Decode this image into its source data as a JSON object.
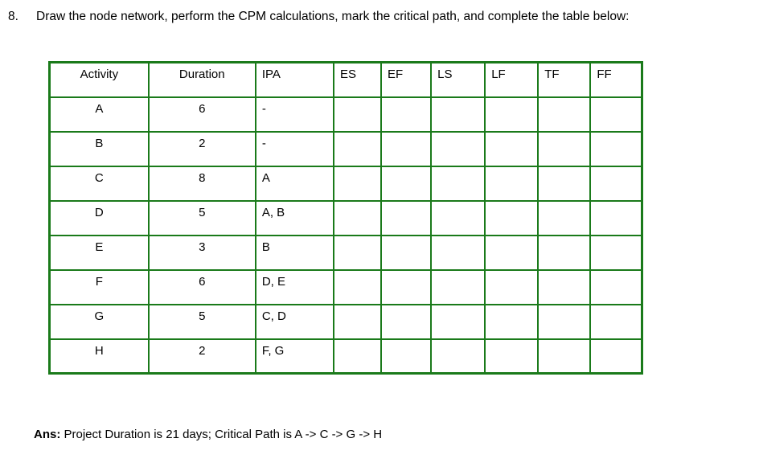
{
  "question": {
    "number": "8.",
    "text": "Draw the node network, perform the CPM calculations, mark the critical path, and complete the table below:"
  },
  "table": {
    "headers": [
      {
        "key": "activity",
        "label": "Activity",
        "align": "center"
      },
      {
        "key": "duration",
        "label": "Duration",
        "align": "center"
      },
      {
        "key": "ipa",
        "label": "IPA",
        "align": "left"
      },
      {
        "key": "es",
        "label": "ES",
        "align": "left"
      },
      {
        "key": "ef",
        "label": "EF",
        "align": "left"
      },
      {
        "key": "ls",
        "label": "LS",
        "align": "left"
      },
      {
        "key": "lf",
        "label": "LF",
        "align": "left"
      },
      {
        "key": "tf",
        "label": "TF",
        "align": "left"
      },
      {
        "key": "ff",
        "label": "FF",
        "align": "left"
      }
    ],
    "rows": [
      {
        "activity": "A",
        "duration": "6",
        "ipa": "-",
        "es": "",
        "ef": "",
        "ls": "",
        "lf": "",
        "tf": "",
        "ff": ""
      },
      {
        "activity": "B",
        "duration": "2",
        "ipa": "-",
        "es": "",
        "ef": "",
        "ls": "",
        "lf": "",
        "tf": "",
        "ff": ""
      },
      {
        "activity": "C",
        "duration": "8",
        "ipa": "A",
        "es": "",
        "ef": "",
        "ls": "",
        "lf": "",
        "tf": "",
        "ff": ""
      },
      {
        "activity": "D",
        "duration": "5",
        "ipa": "A, B",
        "es": "",
        "ef": "",
        "ls": "",
        "lf": "",
        "tf": "",
        "ff": ""
      },
      {
        "activity": "E",
        "duration": "3",
        "ipa": "B",
        "es": "",
        "ef": "",
        "ls": "",
        "lf": "",
        "tf": "",
        "ff": ""
      },
      {
        "activity": "F",
        "duration": "6",
        "ipa": "D, E",
        "es": "",
        "ef": "",
        "ls": "",
        "lf": "",
        "tf": "",
        "ff": ""
      },
      {
        "activity": "G",
        "duration": "5",
        "ipa": "C, D",
        "es": "",
        "ef": "",
        "ls": "",
        "lf": "",
        "tf": "",
        "ff": ""
      },
      {
        "activity": "H",
        "duration": "2",
        "ipa": "F, G",
        "es": "",
        "ef": "",
        "ls": "",
        "lf": "",
        "tf": "",
        "ff": ""
      }
    ],
    "border_color": "#1a7a1a"
  },
  "answer": {
    "lead": "Ans:",
    "text": " Project Duration is 21 days; Critical Path is A -> C -> G -> H"
  }
}
